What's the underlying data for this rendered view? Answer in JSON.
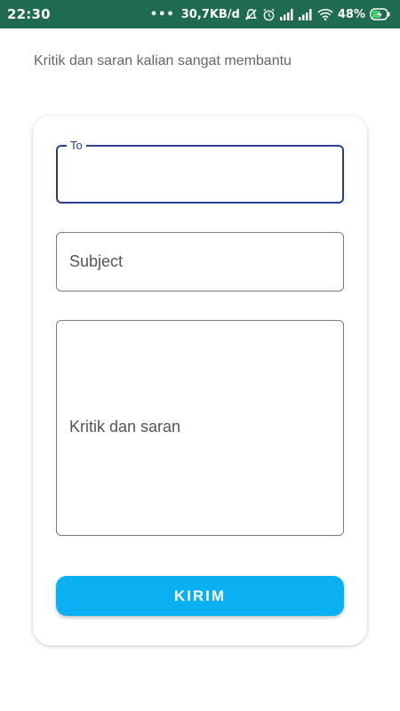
{
  "status_bar": {
    "time": "22:30",
    "network_speed": "30,7KB/d",
    "battery": "48%",
    "icons": [
      "more-dots-icon",
      "mute-icon",
      "alarm-icon",
      "signal-icon",
      "signal-icon",
      "wifi-icon",
      "battery-charging-icon"
    ],
    "bg_color": "#1f6b50"
  },
  "page": {
    "subtitle": "Kritik dan saran kalian sangat membantu"
  },
  "form": {
    "to_label": "To",
    "to_value": "",
    "subject_placeholder": "Subject",
    "message_placeholder": "Kritik dan saran",
    "submit_label": "KIRIM",
    "accent_color": "#2c3d8f",
    "button_color": "#0ab0f2"
  }
}
